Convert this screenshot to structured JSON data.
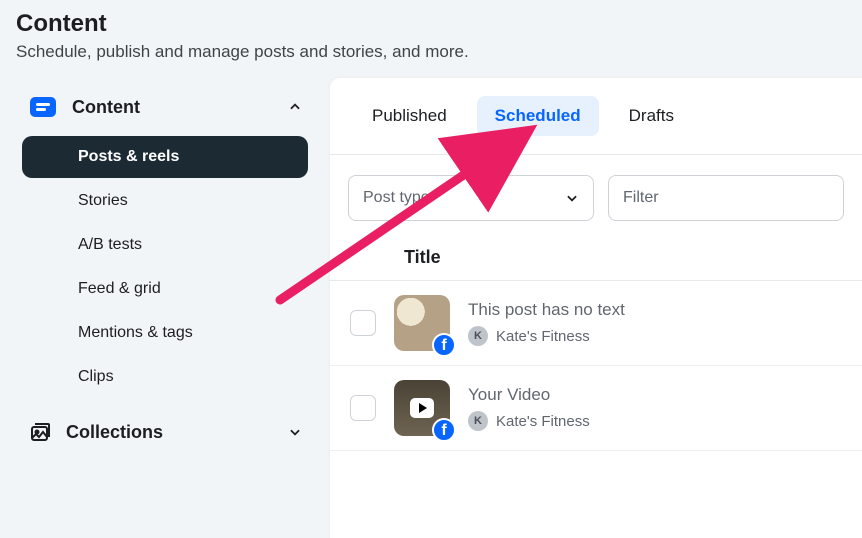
{
  "header": {
    "title": "Content",
    "subtitle": "Schedule, publish and manage posts and stories, and more."
  },
  "sidebar": {
    "groups": [
      {
        "id": "content",
        "label": "Content",
        "expanded": true,
        "items": [
          {
            "label": "Posts & reels",
            "active": true
          },
          {
            "label": "Stories"
          },
          {
            "label": "A/B tests"
          },
          {
            "label": "Feed & grid"
          },
          {
            "label": "Mentions & tags"
          },
          {
            "label": "Clips"
          }
        ]
      },
      {
        "id": "collections",
        "label": "Collections",
        "expanded": false
      }
    ]
  },
  "main": {
    "tabs": [
      {
        "label": "Published",
        "active": false
      },
      {
        "label": "Scheduled",
        "active": true
      },
      {
        "label": "Drafts",
        "active": false
      }
    ],
    "filters": {
      "postTypePlaceholder": "Post type",
      "filterPlaceholder": "Filter"
    },
    "table": {
      "header": "Title",
      "rows": [
        {
          "thumbType": "image",
          "title": "This post has no text",
          "avatarInitial": "K",
          "account": "Kate's Fitness",
          "platform": "facebook"
        },
        {
          "thumbType": "video",
          "title": "Your Video",
          "avatarInitial": "K",
          "account": "Kate's Fitness",
          "platform": "facebook"
        }
      ]
    }
  },
  "annotation": {
    "type": "arrow",
    "color": "#e91e63",
    "targetTab": "Scheduled"
  }
}
